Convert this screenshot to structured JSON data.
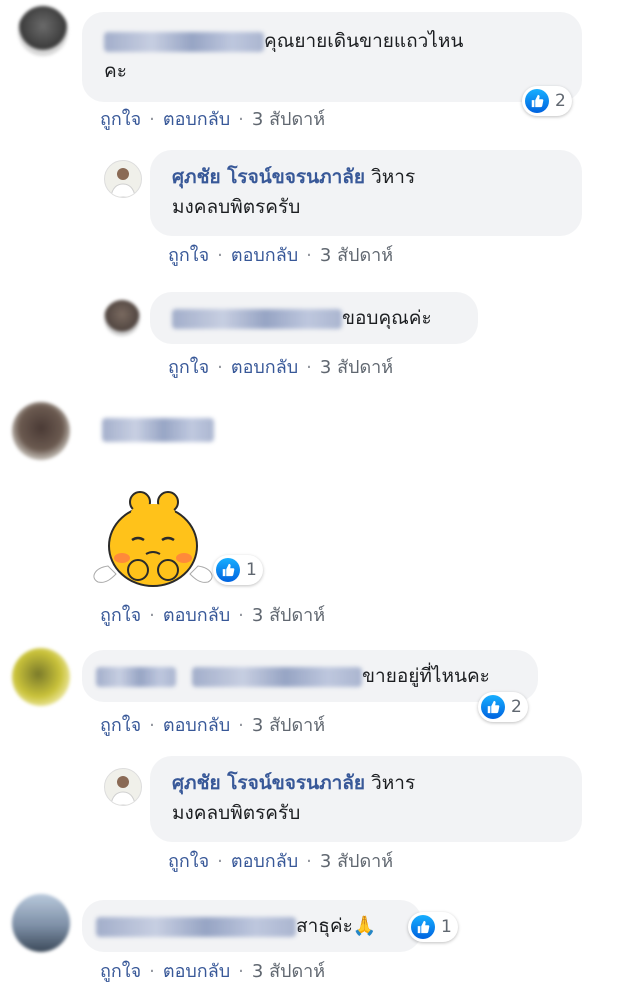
{
  "comments": [
    {
      "text": "คุณยายเดินขายแถวไหน",
      "text2": "คะ",
      "reactions": "2",
      "actions": {
        "like": "ถูกใจ",
        "reply": "ตอบกลับ",
        "time": "3 สัปดาห์"
      }
    },
    {
      "author": "ศุภชัย โรจน์ขจรนภาลัย",
      "text": "วิหาร",
      "text2": "มงคลบพิตรครับ",
      "actions": {
        "like": "ถูกใจ",
        "reply": "ตอบกลับ",
        "time": "3 สัปดาห์"
      }
    },
    {
      "text": "ขอบคุณค่ะ",
      "actions": {
        "like": "ถูกใจ",
        "reply": "ตอบกลับ",
        "time": "3 สัปดาห์"
      }
    },
    {
      "reactions": "1",
      "actions": {
        "like": "ถูกใจ",
        "reply": "ตอบกลับ",
        "time": "3 สัปดาห์"
      }
    },
    {
      "text": "ขายอยู่ที่ไหนคะ",
      "reactions": "2",
      "actions": {
        "like": "ถูกใจ",
        "reply": "ตอบกลับ",
        "time": "3 สัปดาห์"
      }
    },
    {
      "author": "ศุภชัย โรจน์ขจรนภาลัย",
      "text": "วิหาร",
      "text2": "มงคลบพิตรครับ",
      "actions": {
        "like": "ถูกใจ",
        "reply": "ตอบกลับ",
        "time": "3 สัปดาห์"
      }
    },
    {
      "text": "สาธุค่ะ🙏",
      "reactions": "1",
      "actions": {
        "like": "ถูกใจ",
        "reply": "ตอบกลับ",
        "time": "3 สัปดาห์"
      }
    }
  ],
  "colors": {
    "link": "#385898",
    "bubble": "#f2f3f5",
    "like": "#1877f2"
  }
}
